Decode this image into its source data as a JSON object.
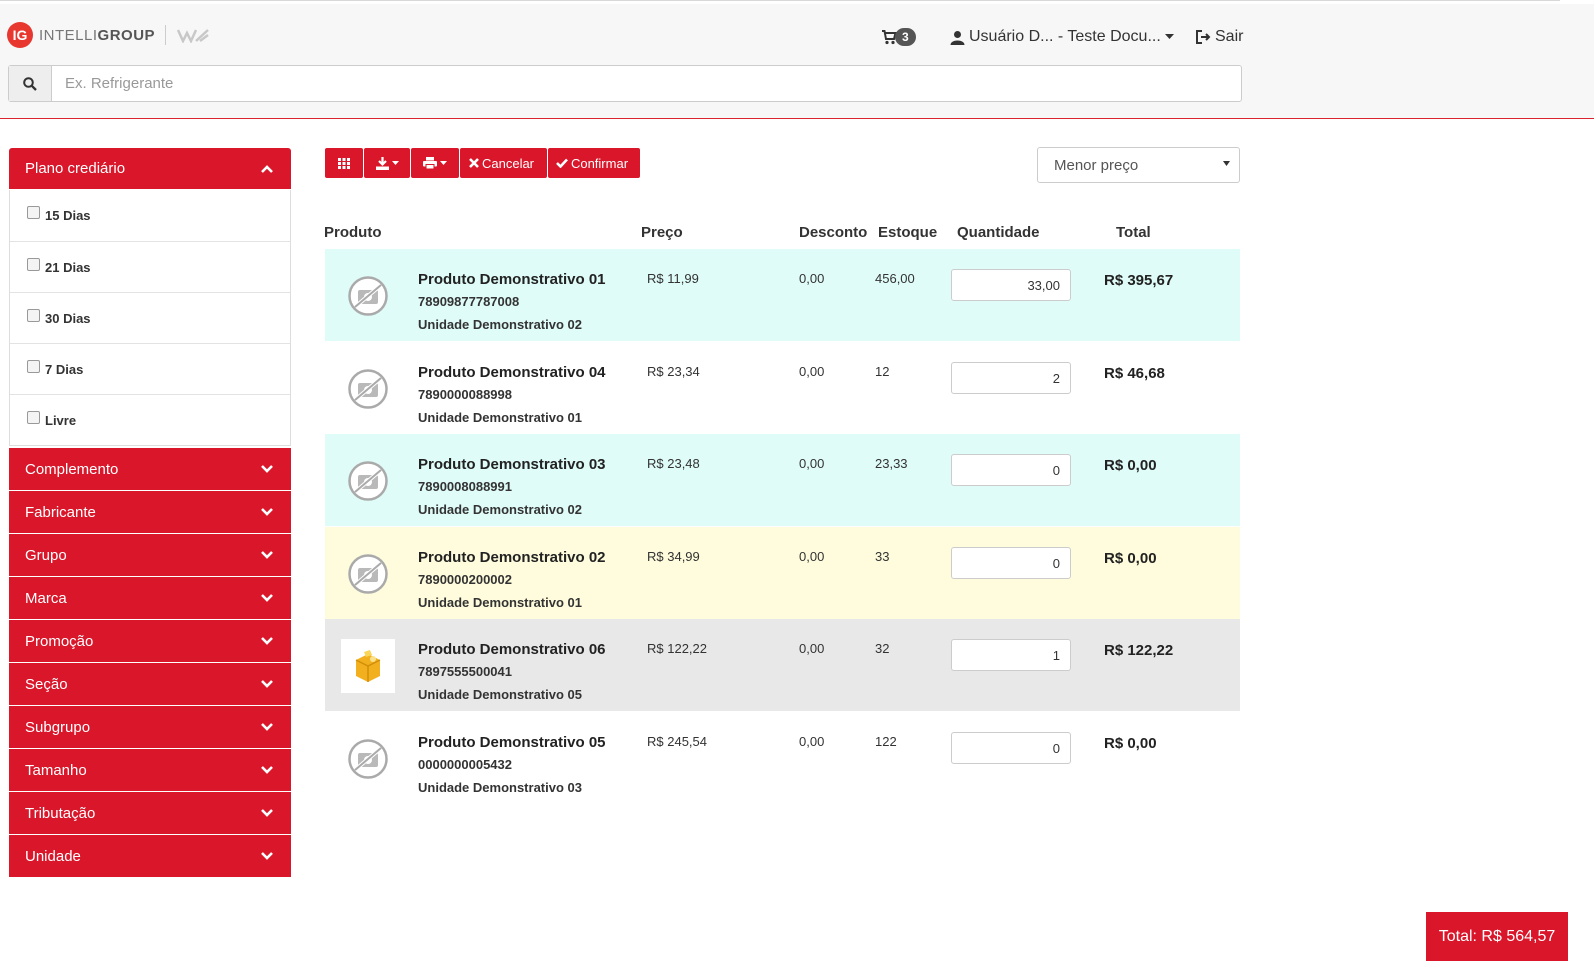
{
  "header": {
    "logo_badge": "IG",
    "logo_text_light": "INTELLI",
    "logo_text_bold": "GROUP",
    "cart_count": "3",
    "user_label": "Usuário D... - Teste Docu...",
    "logout_label": "Sair"
  },
  "search": {
    "placeholder": "Ex. Refrigerante",
    "value": ""
  },
  "sidebar": {
    "plano": {
      "title": "Plano crediário",
      "options": [
        "15 Dias",
        "21 Dias",
        "30 Dias",
        "7 Dias",
        "Livre"
      ]
    },
    "filters": [
      "Complemento",
      "Fabricante",
      "Grupo",
      "Marca",
      "Promoção",
      "Seção",
      "Subgrupo",
      "Tamanho",
      "Tributação",
      "Unidade"
    ]
  },
  "toolbar": {
    "cancel_label": "Cancelar",
    "confirm_label": "Confirmar",
    "sort_selected": "Menor preço"
  },
  "table": {
    "headers": {
      "produto": "Produto",
      "preco": "Preço",
      "desconto": "Desconto",
      "estoque": "Estoque",
      "quantidade": "Quantidade",
      "total": "Total"
    },
    "rows": [
      {
        "name": "Produto Demonstrativo 01",
        "code": "78909877787008",
        "unit": "Unidade Demonstrativo 02",
        "price": "R$ 11,99",
        "discount": "0,00",
        "stock": "456,00",
        "qty": "33,00",
        "total": "R$ 395,67",
        "bg": "#dffcf8",
        "image": "none"
      },
      {
        "name": "Produto Demonstrativo 04",
        "code": "7890000088998",
        "unit": "Unidade Demonstrativo 01",
        "price": "R$ 23,34",
        "discount": "0,00",
        "stock": "12",
        "qty": "2",
        "total": "R$ 46,68",
        "bg": "#ffffff",
        "image": "none"
      },
      {
        "name": "Produto Demonstrativo 03",
        "code": "7890008088991",
        "unit": "Unidade Demonstrativo 02",
        "price": "R$ 23,48",
        "discount": "0,00",
        "stock": "23,33",
        "qty": "0",
        "total": "R$ 0,00",
        "bg": "#dffcf8",
        "image": "none"
      },
      {
        "name": "Produto Demonstrativo 02",
        "code": "7890000200002",
        "unit": "Unidade Demonstrativo 01",
        "price": "R$ 34,99",
        "discount": "0,00",
        "stock": "33",
        "qty": "0",
        "total": "R$ 0,00",
        "bg": "#fefcdc",
        "image": "none"
      },
      {
        "name": "Produto Demonstrativo 06",
        "code": "7897555500041",
        "unit": "Unidade Demonstrativo 05",
        "price": "R$ 122,22",
        "discount": "0,00",
        "stock": "32",
        "qty": "1",
        "total": "R$ 122,22",
        "bg": "#e8e8e8",
        "image": "box"
      },
      {
        "name": "Produto Demonstrativo 05",
        "code": "0000000005432",
        "unit": "Unidade Demonstrativo 03",
        "price": "R$ 245,54",
        "discount": "0,00",
        "stock": "122",
        "qty": "0",
        "total": "R$ 0,00",
        "bg": "#ffffff",
        "image": "none"
      }
    ]
  },
  "footer": {
    "total_label": "Total: R$ 564,57"
  },
  "colors": {
    "accent": "#d9162a",
    "row_cyan": "#dffcf8",
    "row_yellow": "#fefcdc",
    "row_gray": "#e8e8e8"
  },
  "icons": [
    "search-icon",
    "cart-icon",
    "user-icon",
    "logout-icon",
    "chevron-up-icon",
    "chevron-down-icon",
    "grid-icon",
    "download-icon",
    "print-icon",
    "close-icon",
    "check-icon",
    "no-image-icon",
    "product-box-icon"
  ]
}
